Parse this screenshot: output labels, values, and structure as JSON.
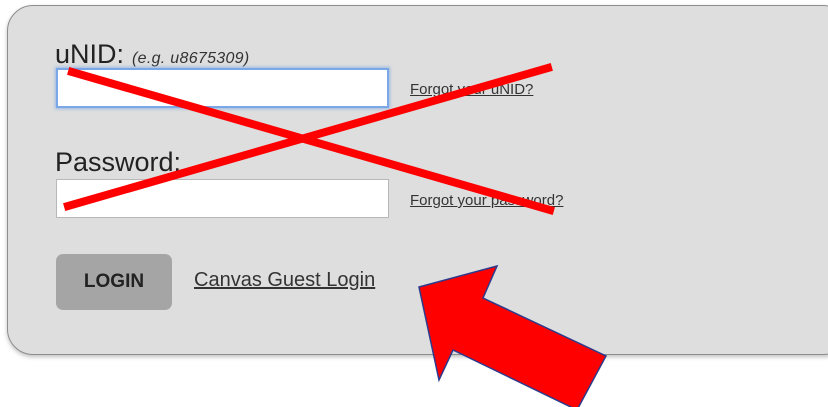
{
  "login_form": {
    "unid_label": "uNID:",
    "unid_hint": "(e.g. u8675309)",
    "unid_value": "",
    "forgot_unid": "Forgot your uNID?",
    "password_label": "Password:",
    "password_value": "",
    "forgot_password": "Forgot your password?",
    "login_button": "LOGIN",
    "guest_login": "Canvas Guest Login"
  },
  "annotations": {
    "cross_color": "#ff0000",
    "arrow_color": "#ff0000",
    "arrow_outline": "#2d3a8c"
  }
}
